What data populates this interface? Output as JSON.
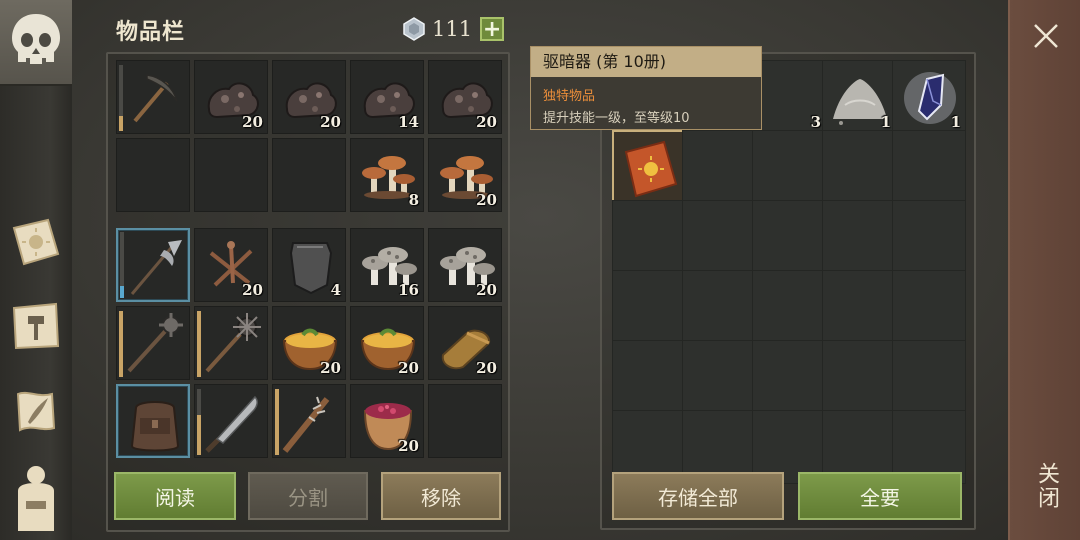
{
  "inventory": {
    "title": "物品栏",
    "currency": "111",
    "currency_add": "+",
    "slots": [
      {
        "item": "pickaxe",
        "count": "",
        "durability": 0.22
      },
      {
        "item": "iron-ore",
        "count": "20"
      },
      {
        "item": "iron-ore",
        "count": "20"
      },
      {
        "item": "iron-ore",
        "count": "14"
      },
      {
        "item": "iron-ore",
        "count": "20"
      },
      {
        "item": "empty",
        "count": ""
      },
      {
        "item": "empty",
        "count": ""
      },
      {
        "item": "empty",
        "count": ""
      },
      {
        "item": "orange-mushroom",
        "count": "8"
      },
      {
        "item": "orange-mushroom",
        "count": "20"
      },
      {
        "item": "halberd",
        "count": "",
        "durability": 0.18,
        "selected": true
      },
      {
        "item": "nails",
        "count": "20"
      },
      {
        "item": "chest-plate",
        "count": "4"
      },
      {
        "item": "grey-mushroom",
        "count": "16"
      },
      {
        "item": "grey-mushroom",
        "count": "20"
      },
      {
        "item": "mace",
        "count": "",
        "durability": 1.0
      },
      {
        "item": "morning-star",
        "count": "",
        "durability": 1.0
      },
      {
        "item": "soup-bowl",
        "count": "20"
      },
      {
        "item": "soup-bowl",
        "count": "20"
      },
      {
        "item": "bread-loaf",
        "count": "20"
      },
      {
        "item": "backpack",
        "count": "",
        "selected": true
      },
      {
        "item": "machete",
        "count": "",
        "durability": 0.6
      },
      {
        "item": "spiked-club",
        "count": "",
        "durability": 1.0
      },
      {
        "item": "berry-bowl",
        "count": "20"
      },
      {
        "item": "empty",
        "count": ""
      }
    ],
    "buttons": {
      "read": "阅读",
      "split": "分割",
      "remove": "移除"
    }
  },
  "storage": {
    "slots": [
      {
        "item": "hidden",
        "count": ""
      },
      {
        "item": "hidden",
        "count": "3"
      },
      {
        "item": "sand-pile",
        "count": "1"
      },
      {
        "item": "crystal",
        "count": "1"
      },
      {
        "item": "empty",
        "count": ""
      },
      {
        "item": "tome",
        "count": "",
        "selected": true
      }
    ],
    "buttons": {
      "store_all": "存储全部",
      "take_all": "全要"
    }
  },
  "tooltip": {
    "title": "驱暗器 (第 10册)",
    "type": "独特物品",
    "desc": "提升技能一级，至等级10"
  },
  "close": {
    "label": "关闭"
  },
  "colors": {
    "accent_green": "#7d9a4a",
    "tooltip_header": "#c2ae86",
    "unique_orange": "#e98d3a"
  }
}
